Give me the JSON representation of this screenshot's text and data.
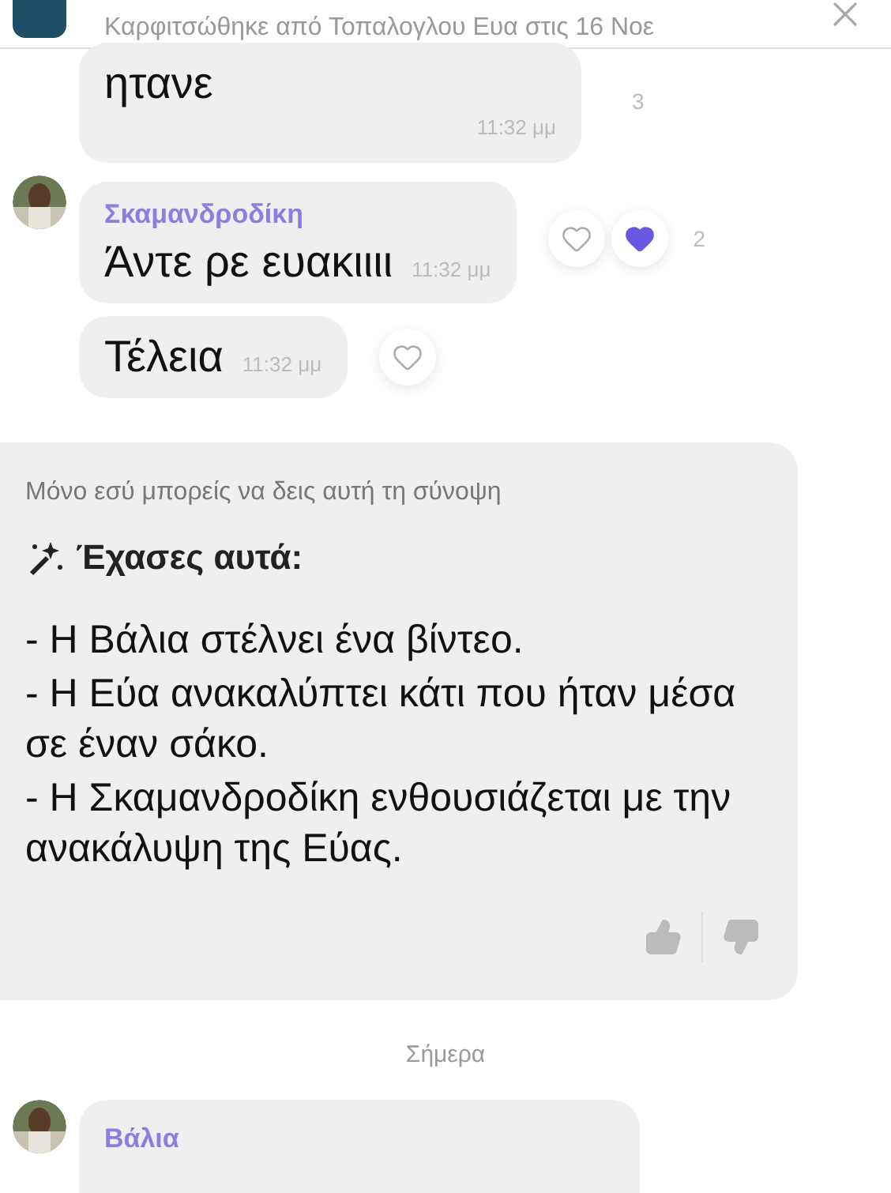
{
  "pinned": {
    "subtitle": "Καρφιτσώθηκε από Τοπαλογλου Ευα στις 16 Νοε"
  },
  "messages": [
    {
      "kind": "continued",
      "text": "ητανε",
      "time": "11:32 μμ",
      "count": "3"
    },
    {
      "kind": "first",
      "sender": "Σκαμανδροδίκη",
      "text": "Άντε ρε ευακιιιι",
      "time": "11:32 μμ",
      "count": "2",
      "reactions": [
        {
          "liked": false
        },
        {
          "liked": true
        }
      ]
    },
    {
      "kind": "continued",
      "text": "Τέλεια",
      "time": "11:32 μμ",
      "reactions": [
        {
          "liked": false
        }
      ]
    }
  ],
  "summary": {
    "note": "Μόνο εσύ μπορείς να δεις αυτή τη σύνοψη",
    "title": "Έχασες αυτά:",
    "lines": [
      "- Η Βάλια στέλνει ένα βίντεο.",
      "- Η Εύα ανακαλύπτει κάτι που ήταν μέσα σε έναν σάκο.",
      "- Η Σκαμανδροδίκη ενθουσιάζεται με την ανακάλυψη της Εύας."
    ]
  },
  "date_divider": "Σήμερα",
  "last_message": {
    "sender": "Βάλια"
  }
}
